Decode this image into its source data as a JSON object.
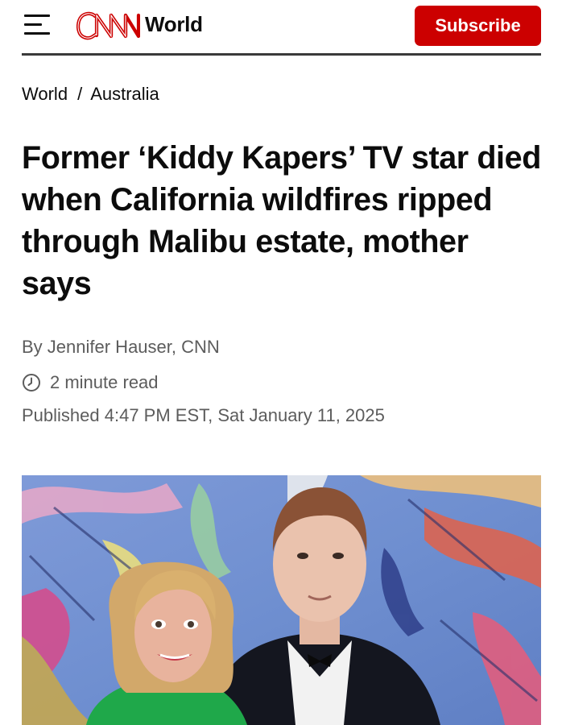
{
  "header": {
    "menu_icon": "hamburger-menu-icon",
    "logo_text": "CNN",
    "section": "World",
    "subscribe_label": "Subscribe",
    "brand_color": "#cc0000"
  },
  "breadcrumb": {
    "items": [
      "World",
      "Australia"
    ],
    "separator": "/"
  },
  "article": {
    "headline": "Former ‘Kiddy Kapers’ TV star died when California wildfires ripped through Malibu estate, mother says",
    "byline_prefix": "By ",
    "author": "Jennifer Hauser",
    "byline_suffix": ", CNN",
    "read_time_icon": "clock-icon",
    "read_time": "2 minute read",
    "published": "Published 4:47 PM EST, Sat January 11, 2025"
  },
  "photo": {
    "icon": "article-photo"
  }
}
